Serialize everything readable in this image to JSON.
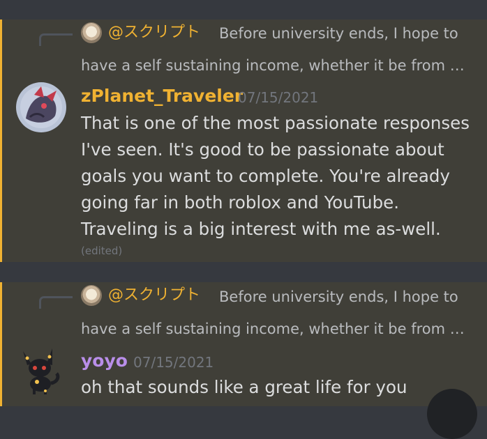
{
  "messages": [
    {
      "reply": {
        "mention": "@スクリプト",
        "preview_line1": "Before university ends, I hope to",
        "preview_line2": "have a self sustaining income, whether it be from …"
      },
      "author": "zPlanet_Traveler",
      "author_color": "#f0b232",
      "timestamp": "07/15/2021",
      "lines": [
        "That is one of the most passionate responses",
        "I've seen. It's good to be passionate about",
        "goals you want to complete. You're already",
        "going far in both roblox and YouTube.",
        "Traveling is a big interest with me as-well."
      ],
      "edited": "(edited)"
    },
    {
      "reply": {
        "mention": "@スクリプト",
        "preview_line1": "Before university ends, I hope to",
        "preview_line2": "have a self sustaining income, whether it be from …"
      },
      "author": "yoyo",
      "author_color": "#b98ee9",
      "timestamp": "07/15/2021",
      "lines": [
        "oh that sounds like a great life for you"
      ]
    }
  ],
  "colors": {
    "background": "#36393f",
    "highlight": "#403f38",
    "mention_bar": "#f0b232"
  }
}
